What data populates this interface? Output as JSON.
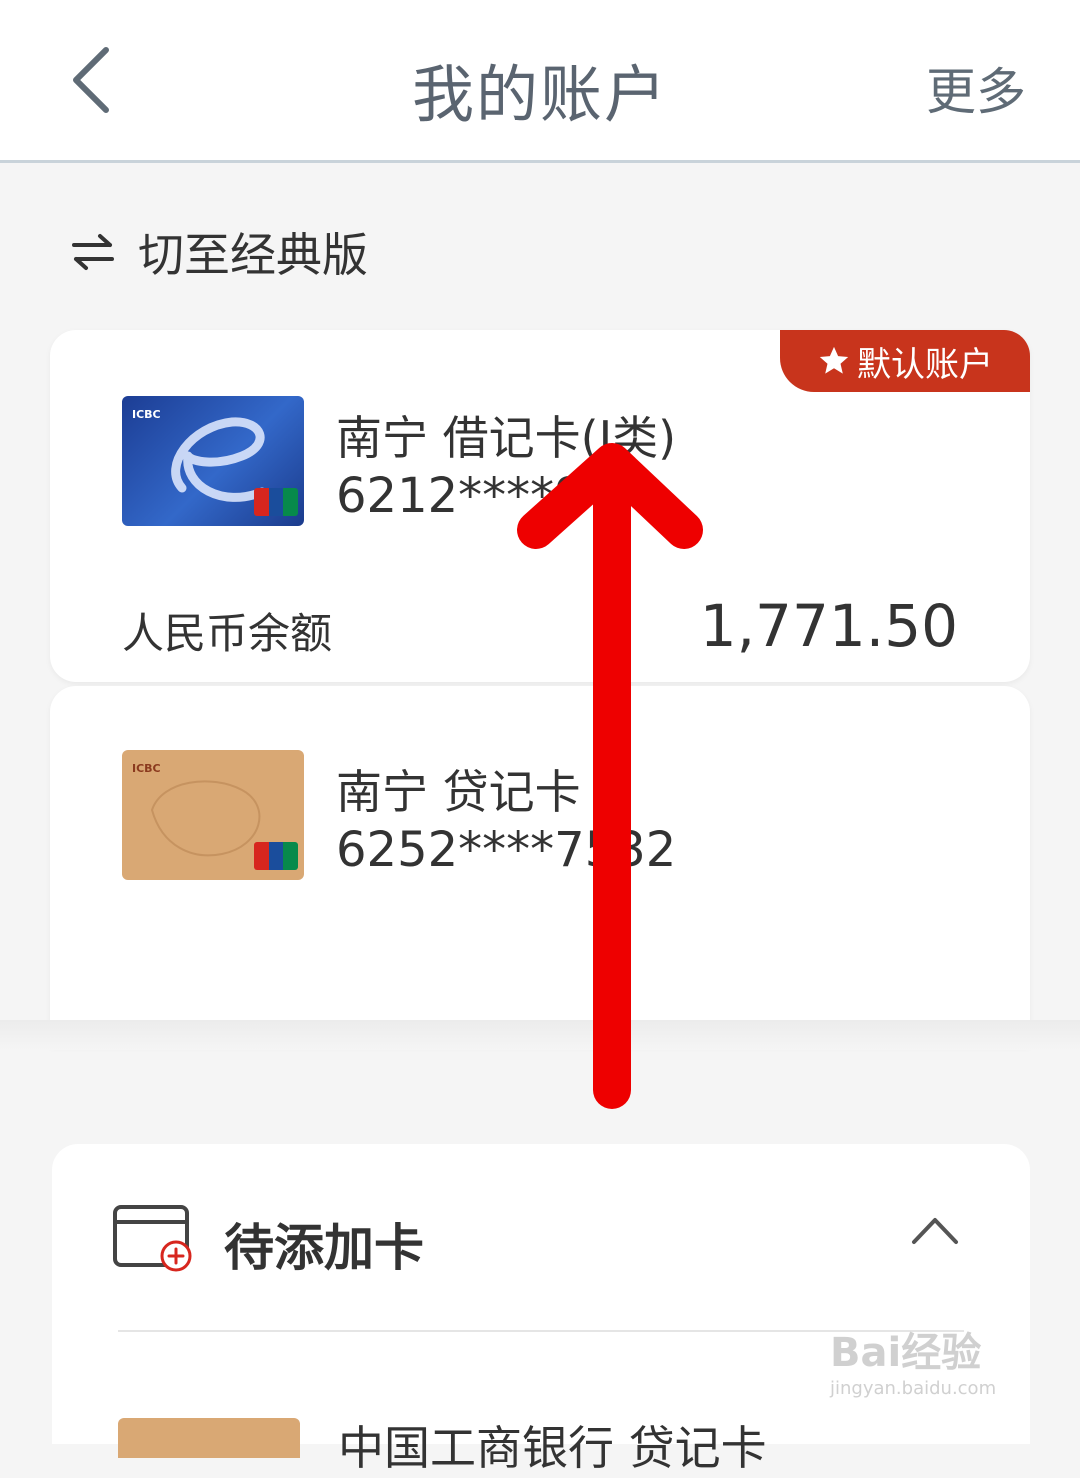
{
  "header": {
    "title": "我的账户",
    "more_label": "更多"
  },
  "switch_label": "切至经典版",
  "cards": [
    {
      "name": "南宁 借记卡(I类)",
      "number": "6212****9",
      "badge": "默认账户",
      "balance_label": "人民币余额",
      "balance": "1,771.50",
      "card_brand": "ICBC"
    },
    {
      "name": "南宁 贷记卡",
      "number": "6252****7532",
      "card_brand": "ICBC"
    }
  ],
  "pending": {
    "title": "待添加卡",
    "first_item": "中国工商银行 贷记卡"
  },
  "watermark": {
    "brand": "Bai经验",
    "url": "jingyan.baidu.com"
  },
  "colors": {
    "badge": "#c8341c",
    "annotation_arrow": "#ee0000"
  }
}
